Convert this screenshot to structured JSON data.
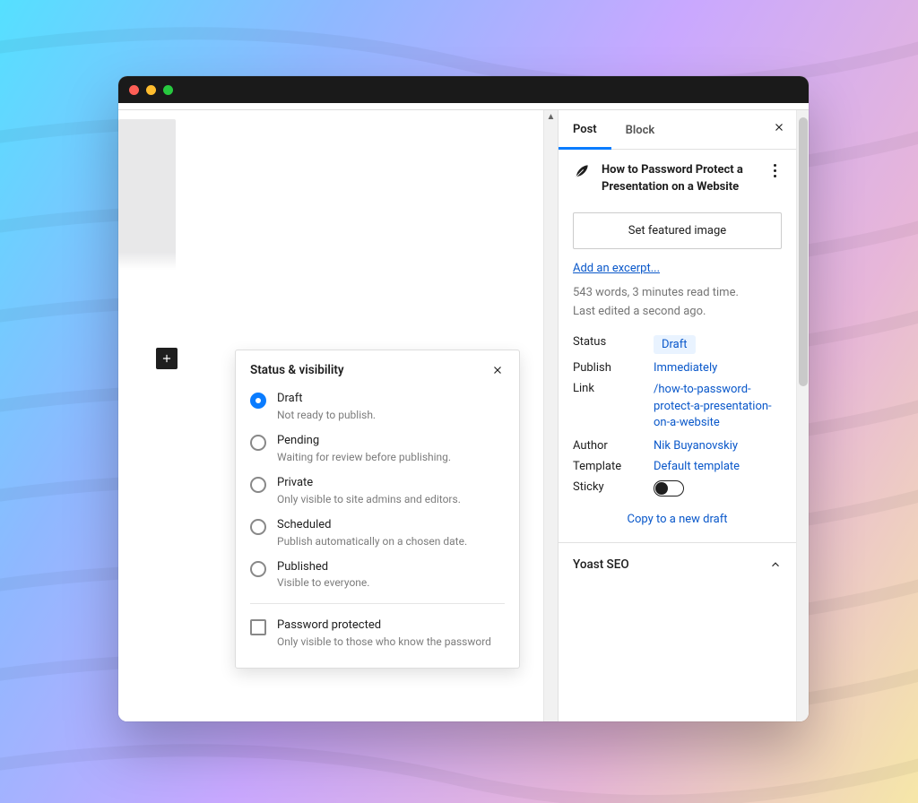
{
  "sidebar": {
    "tabs": {
      "post": "Post",
      "block": "Block"
    },
    "doc_title": "How to Password Protect a Presentation on a Website",
    "featured_button": "Set featured image",
    "excerpt_link": "Add an excerpt...",
    "meta_line1": "543 words, 3 minutes read time.",
    "meta_line2": "Last edited a second ago.",
    "rows": {
      "status": {
        "label": "Status",
        "value": "Draft"
      },
      "publish": {
        "label": "Publish",
        "value": "Immediately"
      },
      "link": {
        "label": "Link",
        "value": "/how-to-password-protect-a-presentation-on-a-website"
      },
      "author": {
        "label": "Author",
        "value": "Nik Buyanovskiy"
      },
      "template": {
        "label": "Template",
        "value": "Default template"
      },
      "sticky": {
        "label": "Sticky"
      }
    },
    "copy_draft": "Copy to a new draft",
    "panel_yoast": "Yoast SEO"
  },
  "popover": {
    "title": "Status & visibility",
    "options": {
      "draft": {
        "label": "Draft",
        "desc": "Not ready to publish."
      },
      "pending": {
        "label": "Pending",
        "desc": "Waiting for review before publishing."
      },
      "private": {
        "label": "Private",
        "desc": "Only visible to site admins and editors."
      },
      "scheduled": {
        "label": "Scheduled",
        "desc": "Publish automatically on a chosen date."
      },
      "published": {
        "label": "Published",
        "desc": "Visible to everyone."
      }
    },
    "password": {
      "label": "Password protected",
      "desc": "Only visible to those who know the password"
    }
  }
}
